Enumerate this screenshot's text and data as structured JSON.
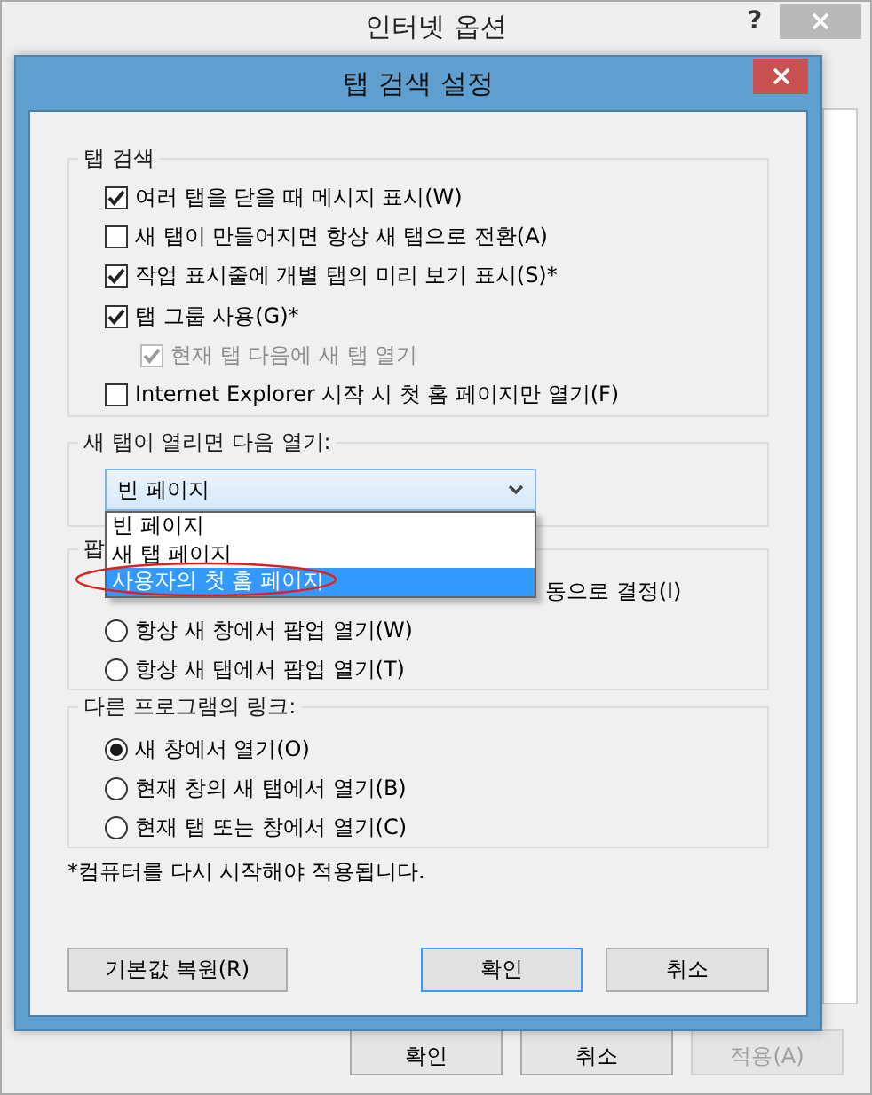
{
  "back_window": {
    "title": "인터넷 옵션",
    "help": "?",
    "buttons": [
      {
        "label": "확인",
        "disabled": false
      },
      {
        "label": "취소",
        "disabled": false
      },
      {
        "label": "적용(A)",
        "disabled": true
      }
    ]
  },
  "dialog": {
    "title": "탭 검색 설정"
  },
  "tab_group": {
    "title": "탭 검색",
    "options": [
      {
        "label": "여러 탭을 닫을 때 메시지 표시(W)",
        "checked": true,
        "disabled": false
      },
      {
        "label": "새 탭이 만들어지면 항상 새 탭으로 전환(A)",
        "checked": false,
        "disabled": false
      },
      {
        "label": "작업 표시줄에 개별 탭의 미리 보기 표시(S)*",
        "checked": true,
        "disabled": false
      },
      {
        "label": "탭 그룹 사용(G)*",
        "checked": true,
        "disabled": false,
        "children": [
          {
            "label": "현재 탭 다음에 새 탭 열기",
            "checked": true,
            "disabled": true
          }
        ]
      },
      {
        "label": "Internet Explorer 시작 시 첫 홈 페이지만 열기(F)",
        "checked": false,
        "disabled": false
      }
    ]
  },
  "new_tab_group": {
    "title": "새 탭이 열리면 다음 열기:",
    "combo": {
      "value": "빈 페이지",
      "expanded": true
    },
    "list": [
      {
        "label": "빈 페이지",
        "selected": false,
        "circled": false
      },
      {
        "label": "새 탭 페이지",
        "selected": false,
        "circled": false
      },
      {
        "label": "사용자의 첫 홈 페이지",
        "selected": true,
        "circled": true
      }
    ]
  },
  "popup_group": {
    "title": "팝",
    "covered_option": "동으로 결정(I)",
    "options": [
      {
        "label": "항상 새 창에서 팝업 열기(W)",
        "selected": false
      },
      {
        "label": "항상 새 탭에서 팝업 열기(T)",
        "selected": false
      }
    ]
  },
  "links_group": {
    "title": "다른 프로그램의 링크:",
    "options": [
      {
        "label": "새 창에서 열기(O)",
        "selected": true
      },
      {
        "label": "현재 창의 새 탭에서 열기(B)",
        "selected": false
      },
      {
        "label": "현재 탭 또는 창에서 열기(C)",
        "selected": false
      }
    ]
  },
  "footnote": "*컴퓨터를 다시 시작해야 적용됩니다.",
  "buttons": [
    {
      "label": "기본값 복원(R)",
      "default": false
    },
    {
      "label": "확인",
      "default": true
    },
    {
      "label": "취소",
      "default": false
    }
  ]
}
